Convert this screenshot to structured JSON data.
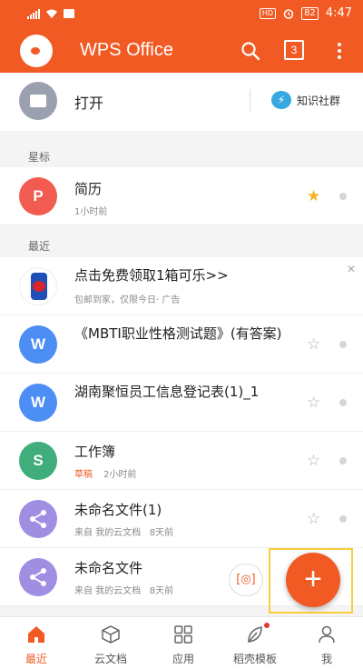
{
  "status_bar": {
    "network_badge": "HD",
    "battery": "82",
    "time": "4:47"
  },
  "app_bar": {
    "title": "WPS Office",
    "tab_count": "3"
  },
  "open_row": {
    "label": "打开",
    "community_label": "知识社群"
  },
  "sections": {
    "starred": "星标",
    "recent": "最近"
  },
  "starred_items": [
    {
      "title": "简历",
      "meta": "1小时前",
      "icon_letter": "P",
      "starred": true
    }
  ],
  "recent_items": [
    {
      "title": "点击免费领取1箱可乐>>",
      "meta": "包邮到家，仅限今日· 广告",
      "is_ad": true
    },
    {
      "title": "《MBTI职业性格测试题》(有答案)",
      "icon_letter": "W",
      "starred": false
    },
    {
      "title": "湖南聚恒员工信息登记表(1)_1",
      "icon_letter": "W",
      "starred": false
    },
    {
      "title": "工作簿",
      "badge": "草稿",
      "meta": "2小时前",
      "icon_letter": "S",
      "starred": false
    },
    {
      "title": "未命名文件(1)",
      "meta_from": "来自 我的云文档",
      "meta_time": "8天前",
      "starred": false
    },
    {
      "title": "未命名文件",
      "meta_from": "来自 我的云文档",
      "meta_time": "8天前",
      "starred": false
    }
  ],
  "fab": {
    "label": "+"
  },
  "bottom_nav": {
    "tabs": [
      {
        "label": "最近",
        "active": true
      },
      {
        "label": "云文档"
      },
      {
        "label": "应用"
      },
      {
        "label": "稻壳模板",
        "has_dot": true
      },
      {
        "label": "我"
      }
    ]
  },
  "colors": {
    "brand": "#f25a23",
    "star_active": "#f5b320",
    "highlight_box": "#f7cf3a"
  }
}
